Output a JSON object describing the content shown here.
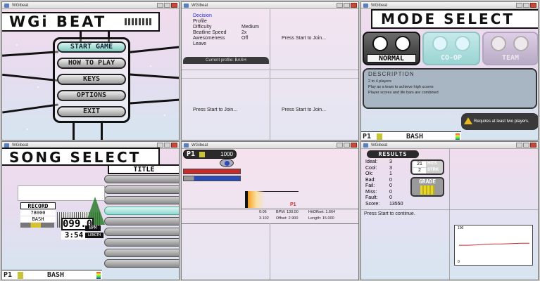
{
  "windows": {
    "title": "WGibeat"
  },
  "main_menu": {
    "banner": "WGi BEAT",
    "items": [
      "START GAME",
      "HOW TO PLAY",
      "KEYS",
      "OPTIONS",
      "EXIT"
    ]
  },
  "profile_select": {
    "menu": [
      {
        "label": "Decision",
        "value": ""
      },
      {
        "label": "Profile",
        "value": ""
      },
      {
        "label": "Difficulty",
        "value": "Medium"
      },
      {
        "label": "Beatline Speed",
        "value": "2x"
      },
      {
        "label": "Awesomeness",
        "value": "Off"
      },
      {
        "label": "Leave",
        "value": ""
      }
    ],
    "current_profile": "Current profile: BASH",
    "join_prompt": "Press Start to Join..."
  },
  "mode_select": {
    "banner": "MODE SELECT",
    "modes": [
      "NORMAL",
      "CO-OP",
      "TEAM"
    ],
    "description_heading": "DESCRIPTION",
    "description_lines": [
      "2 to 4 players",
      "Play as a team to achieve high scores",
      "Player scores and life bars are combined"
    ],
    "warning": "Requires at least two players.",
    "player": {
      "tag": "P1",
      "name": "BASH"
    }
  },
  "song_select": {
    "banner": "SONG SELECT",
    "sort_label": "TITLE",
    "record_label": "RECORD",
    "record_value": "78000",
    "record_player": "BASH",
    "bpm_value": "099.0",
    "bpm_label": "BPM",
    "length_value": "3:54",
    "length_label": "LENGTH",
    "player": {
      "tag": "P1",
      "name": "BASH"
    },
    "colors": {
      "selected": "#8ed8d0"
    }
  },
  "gameplay": {
    "player_tag": "P1",
    "score": "1000",
    "beatline_marker": "P1",
    "debug": {
      "row1": [
        "0:06",
        "BPM: 130.00",
        "HitOffset: 1.664"
      ],
      "row2": [
        "3.102",
        "Offset: 2.900",
        "Length: 15.000"
      ]
    },
    "colors": {
      "life": "#c62b2b",
      "momentum": "#2b4bb8"
    }
  },
  "results": {
    "heading": "RESULTS",
    "rows": [
      {
        "label": "Ideal:",
        "value": "3"
      },
      {
        "label": "Cool:",
        "value": "3"
      },
      {
        "label": "Ok:",
        "value": "1"
      },
      {
        "label": "Bad:",
        "value": "0"
      },
      {
        "label": "Fail:",
        "value": "0"
      },
      {
        "label": "Miss:",
        "value": "0"
      },
      {
        "label": "Fault:",
        "value": "0"
      },
      {
        "label": "Score:",
        "value": "13550"
      }
    ],
    "hits_value": "21",
    "hits_label": "HITS",
    "streak_value": "2",
    "streak_label": "STRK",
    "grade_label": "GRADE",
    "continue_prompt": "Press Start to continue.",
    "graph": {
      "y_top": "100",
      "y_bottom": "0",
      "type": "line",
      "values": [
        52,
        52,
        53,
        55,
        56,
        56,
        57,
        58,
        58
      ]
    }
  }
}
